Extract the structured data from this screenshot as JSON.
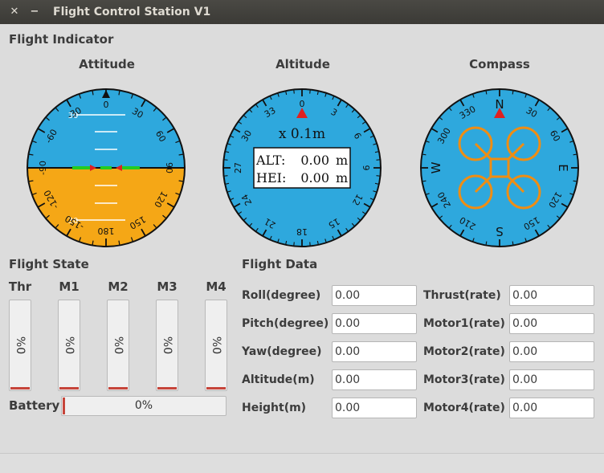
{
  "window": {
    "title": "Flight Control Station V1",
    "close_glyph": "✕",
    "minimize_glyph": "−"
  },
  "flight_indicator": {
    "label": "Flight Indicator",
    "attitude": {
      "title": "Attitude",
      "roll_labels": [
        "0",
        "30",
        "-30",
        "60",
        "-60",
        "90",
        "-90",
        "120",
        "-120",
        "150",
        "-150",
        "180"
      ],
      "pitch_labels": [
        "30",
        "30"
      ],
      "sky_color": "#2ea8dd",
      "ground_color": "#f5a716"
    },
    "altitude": {
      "title": "Altitude",
      "scale_labels": [
        "0",
        "3",
        "6",
        "9",
        "12",
        "15",
        "18",
        "21",
        "24",
        "27",
        "30",
        "33"
      ],
      "multiplier": "x 0.1m",
      "alt_label": "ALT:",
      "alt_value": "0.00",
      "alt_unit": "m",
      "hei_label": "HEI:",
      "hei_value": "0.00",
      "hei_unit": "m",
      "dial_color": "#2ea8dd"
    },
    "compass": {
      "title": "Compass",
      "cardinals": [
        "N",
        "E",
        "S",
        "W"
      ],
      "degree_labels": [
        "30",
        "60",
        "120",
        "150",
        "210",
        "240",
        "300",
        "330"
      ],
      "dial_color": "#2ea8dd",
      "drone_color": "#f08d12"
    }
  },
  "flight_state": {
    "label": "Flight State",
    "bars": [
      {
        "label": "Thr",
        "text": "%0",
        "value": 0
      },
      {
        "label": "M1",
        "text": "%0",
        "value": 0
      },
      {
        "label": "M2",
        "text": "%0",
        "value": 0
      },
      {
        "label": "M3",
        "text": "%0",
        "value": 0
      },
      {
        "label": "M4",
        "text": "%0",
        "value": 0
      }
    ],
    "battery": {
      "label": "Battery",
      "text": "0%",
      "value": 0
    },
    "indicator_color": "#c6453a"
  },
  "flight_data": {
    "label": "Flight Data",
    "left": [
      {
        "label": "Roll(degree)",
        "value": "0.00"
      },
      {
        "label": "Pitch(degree)",
        "value": "0.00"
      },
      {
        "label": "Yaw(degree)",
        "value": "0.00"
      },
      {
        "label": "Altitude(m)",
        "value": "0.00"
      },
      {
        "label": "Height(m)",
        "value": "0.00"
      }
    ],
    "right": [
      {
        "label": "Thrust(rate)",
        "value": "0.00"
      },
      {
        "label": "Motor1(rate)",
        "value": "0.00"
      },
      {
        "label": "Motor2(rate)",
        "value": "0.00"
      },
      {
        "label": "Motor3(rate)",
        "value": "0.00"
      },
      {
        "label": "Motor4(rate)",
        "value": "0.00"
      }
    ]
  }
}
